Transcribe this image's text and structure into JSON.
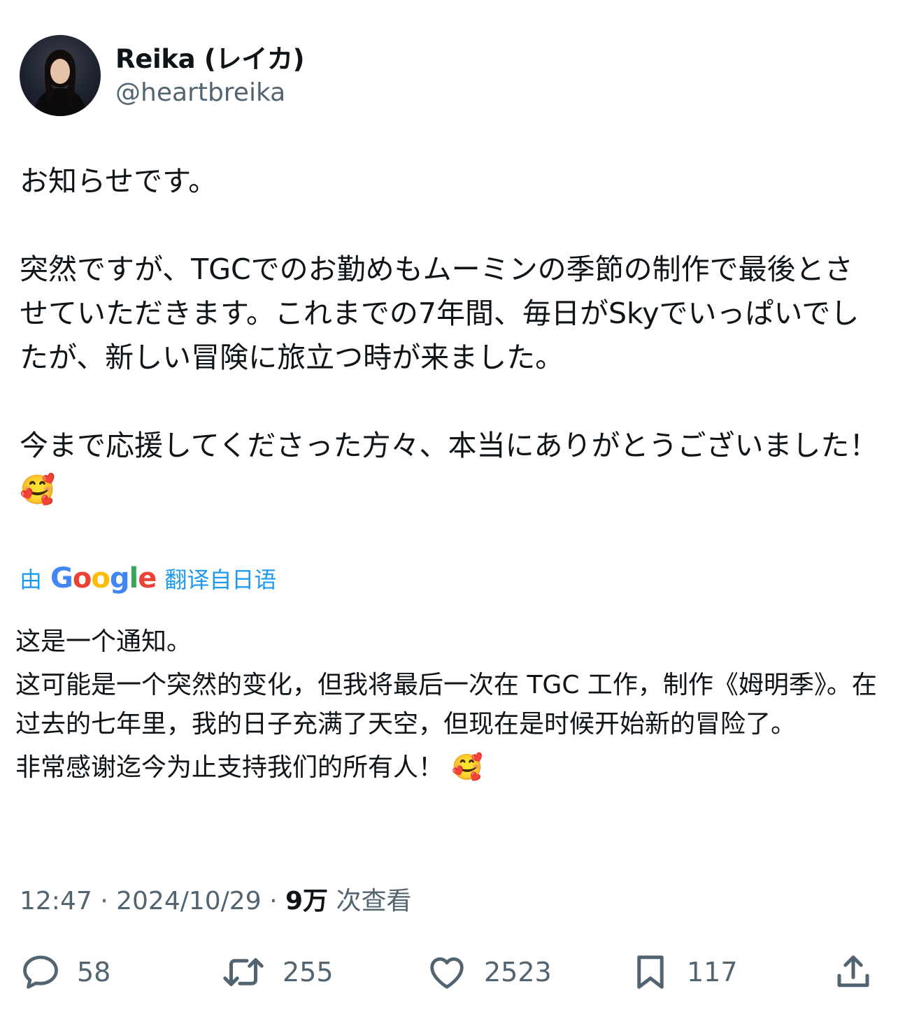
{
  "author": {
    "display_name": "Reika (レイカ)",
    "handle": "@heartbreika"
  },
  "tweet": {
    "paragraphs": [
      "お知らせです。",
      "突然ですが、TGCでのお勤めもムーミンの季節の制作で最後とさせていただきます。これまでの7年間、毎日がSkyでいっぱいでしたが、新しい冒険に旅立つ時が来ました。",
      "今まで応援してくださった方々、本当にありがとうございました！ 🥰"
    ]
  },
  "translation": {
    "prefix": "由",
    "google_logo": "Google",
    "suffix": "翻译自日语",
    "paragraphs": [
      "这是一个通知。",
      "这可能是一个突然的变化，但我将最后一次在 TGC 工作，制作《姆明季》。在过去的七年里，我的日子充满了天空，但现在是时候开始新的冒险了。",
      "非常感谢迄今为止支持我们的所有人！ 🥰"
    ]
  },
  "meta": {
    "time": "12:47",
    "separator": "·",
    "date": "2024/10/29",
    "views_count": "9万",
    "views_label": "次查看"
  },
  "actions": {
    "replies": "58",
    "reposts": "255",
    "likes": "2523",
    "bookmarks": "117"
  },
  "icons": {
    "reply": "reply-icon",
    "repost": "repost-icon",
    "like": "heart-icon",
    "bookmark": "bookmark-icon",
    "share": "share-icon"
  },
  "colors": {
    "text": "#0f1419",
    "secondary": "#536471",
    "link": "#1d9bf0"
  }
}
